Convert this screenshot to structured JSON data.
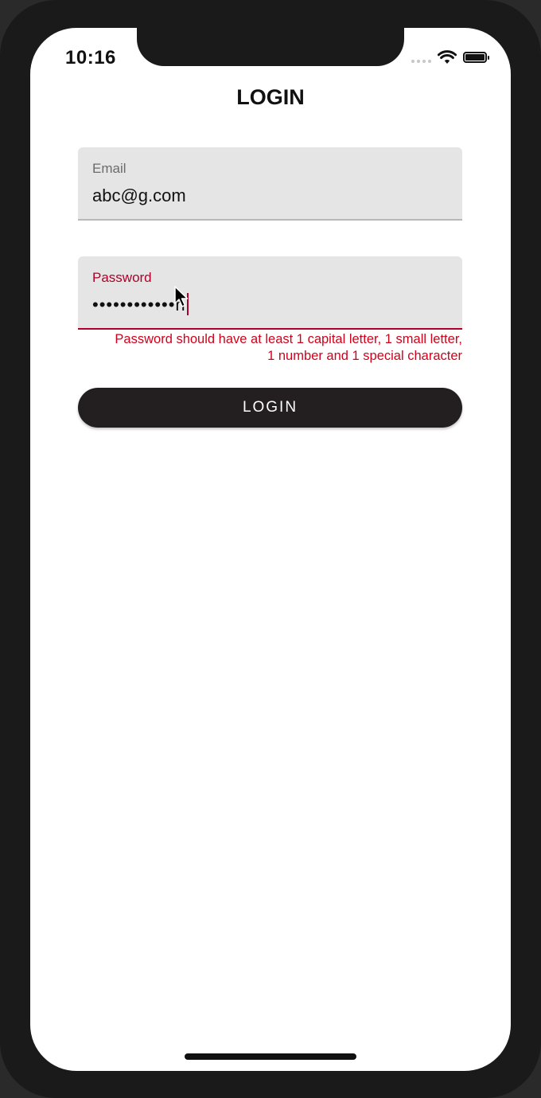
{
  "status_bar": {
    "time": "10:16"
  },
  "header": {
    "title": "LOGIN"
  },
  "email_field": {
    "label": "Email",
    "value": "abc@g.com"
  },
  "password_field": {
    "label": "Password",
    "masked_value": "••••••••••••n",
    "error_message": "Password should have at least 1 capital letter, 1 small letter, 1 number and 1 special character"
  },
  "login_button": {
    "label": "LOGIN"
  },
  "colors": {
    "error": "#d0021b",
    "accent_underline": "#b0002a",
    "button_bg": "#231f20",
    "field_bg": "#e5e5e5"
  },
  "icons": [
    "signal-icon",
    "wifi-icon",
    "battery-icon",
    "mouse-cursor-icon"
  ]
}
